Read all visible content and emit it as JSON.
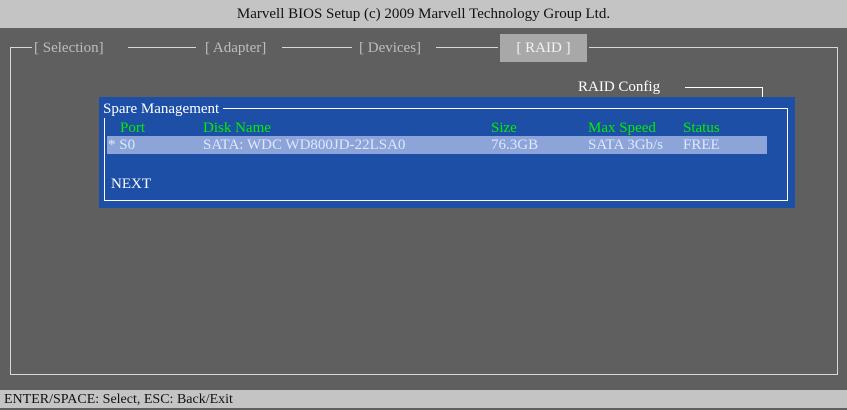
{
  "window": {
    "title": "Marvell BIOS Setup (c) 2009 Marvell Technology Group Ltd."
  },
  "tabs": [
    {
      "label": "[ Selection]"
    },
    {
      "label": "[ Adapter]"
    },
    {
      "label": "[ Devices]"
    },
    {
      "label": "[ RAID ]",
      "active": true
    }
  ],
  "section": {
    "label": "RAID Config"
  },
  "dialog": {
    "title": "Spare Management",
    "columns": [
      "Port",
      "Disk Name",
      "Size",
      "Max Speed",
      "Status"
    ],
    "rows": [
      {
        "port": "* S0",
        "disk_name": "SATA: WDC WD800JD-22LSA0",
        "size": "76.3GB",
        "max_speed": "SATA 3Gb/s",
        "status": "FREE"
      }
    ],
    "next_label": "NEXT"
  },
  "status_bar": {
    "text": "ENTER/SPACE: Select, ESC: Back/Exit"
  },
  "colors": {
    "background": "#5f5f5f",
    "title_bar": "#c4c4c4",
    "dialog_blue": "#1d4fa6",
    "header_green": "#00ee00",
    "row_highlight": "#8da4d8"
  }
}
